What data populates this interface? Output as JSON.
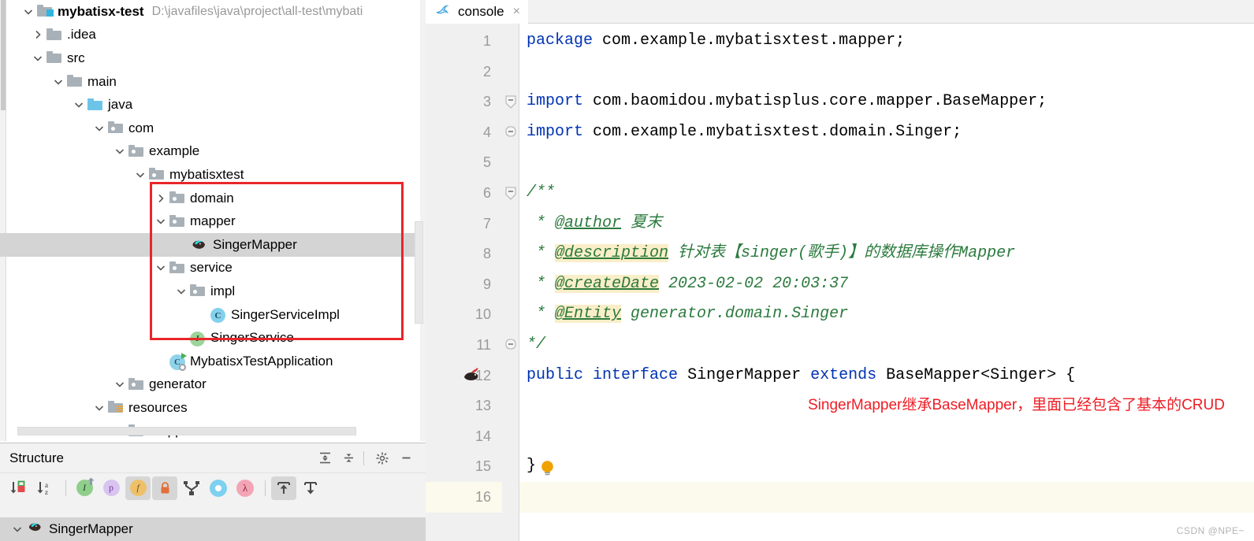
{
  "project": {
    "root": {
      "name": "mybatisx-test",
      "path": "D:\\javafiles\\java\\project\\all-test\\mybati"
    },
    "tree": [
      {
        "label": ".idea",
        "indent": 1,
        "chevron": "right",
        "icon": "folder",
        "selected": false
      },
      {
        "label": "src",
        "indent": 1,
        "chevron": "down",
        "icon": "folder",
        "selected": false
      },
      {
        "label": "main",
        "indent": 2,
        "chevron": "down",
        "icon": "folder",
        "selected": false
      },
      {
        "label": "java",
        "indent": 3,
        "chevron": "down",
        "icon": "folder-blue",
        "selected": false
      },
      {
        "label": "com",
        "indent": 4,
        "chevron": "down",
        "icon": "folder-package",
        "selected": false
      },
      {
        "label": "example",
        "indent": 5,
        "chevron": "down",
        "icon": "folder-package",
        "selected": false
      },
      {
        "label": "mybatisxtest",
        "indent": 6,
        "chevron": "down",
        "icon": "folder-package",
        "selected": false
      },
      {
        "label": "domain",
        "indent": 7,
        "chevron": "right",
        "icon": "folder-package",
        "selected": false
      },
      {
        "label": "mapper",
        "indent": 7,
        "chevron": "down",
        "icon": "folder-package",
        "selected": false
      },
      {
        "label": "SingerMapper",
        "indent": 8,
        "chevron": "none",
        "icon": "mybatis-mapper",
        "selected": true
      },
      {
        "label": "service",
        "indent": 7,
        "chevron": "down",
        "icon": "folder-package",
        "selected": false
      },
      {
        "label": "impl",
        "indent": 8,
        "chevron": "down",
        "icon": "folder-package",
        "selected": false
      },
      {
        "label": "SingerServiceImpl",
        "indent": 9,
        "chevron": "none",
        "icon": "class",
        "selected": false
      },
      {
        "label": "SingerService",
        "indent": 8,
        "chevron": "none",
        "icon": "interface",
        "selected": false
      },
      {
        "label": "MybatisxTestApplication",
        "indent": 7,
        "chevron": "none",
        "icon": "spring-boot",
        "selected": false
      },
      {
        "label": "generator",
        "indent": 5,
        "chevron": "down",
        "icon": "folder-package",
        "selected": false
      },
      {
        "label": "resources",
        "indent": 4,
        "chevron": "down",
        "icon": "folder-resources",
        "selected": false
      },
      {
        "label": "mapper",
        "indent": 5,
        "chevron": "right",
        "icon": "folder",
        "selected": false
      }
    ]
  },
  "structure": {
    "title": "Structure",
    "header_icons": [
      "expand-all-icon",
      "collapse-all-icon",
      "gear-icon",
      "minimize-icon"
    ],
    "toolbar_icons": [
      "sort-by-visibility-icon",
      "sort-alphabetically-icon",
      "show-inherited-icon",
      "show-properties-icon",
      "show-fields-icon",
      "show-non-public-icon",
      "group-by-implementation-icon",
      "show-anonymous-classes-icon",
      "show-lambdas-icon",
      "scroll-from-source-icon",
      "scroll-to-source-icon"
    ],
    "root_item": {
      "label": "SingerMapper",
      "icon": "mybatis-mapper",
      "expanded": true,
      "selected": true
    }
  },
  "editor": {
    "tab": {
      "label": "console",
      "icon": "mysql-dolphin-icon",
      "close": "×"
    },
    "current_line": 16,
    "watermark": "CSDN @NPE~",
    "lines": [
      {
        "n": 1,
        "fold": "none",
        "segments": [
          {
            "t": "package",
            "c": "kw"
          },
          {
            "t": " com.example.mybatisxtest.mapper;",
            "c": "gen"
          }
        ]
      },
      {
        "n": 2,
        "fold": "none",
        "segments": []
      },
      {
        "n": 3,
        "fold": "start",
        "segments": [
          {
            "t": "import",
            "c": "kw"
          },
          {
            "t": " com.baomidou.mybatisplus.core.mapper.BaseMapper;",
            "c": "gen"
          }
        ]
      },
      {
        "n": 4,
        "fold": "end",
        "segments": [
          {
            "t": "import",
            "c": "kw"
          },
          {
            "t": " com.example.mybatisxtest.domain.Singer;",
            "c": "gen"
          }
        ]
      },
      {
        "n": 5,
        "fold": "none",
        "segments": []
      },
      {
        "n": 6,
        "fold": "start",
        "segments": [
          {
            "t": "/**",
            "c": "cmt"
          }
        ]
      },
      {
        "n": 7,
        "fold": "none",
        "segments": [
          {
            "t": " * ",
            "c": "cmt"
          },
          {
            "t": "@author",
            "c": "cmt-tag"
          },
          {
            "t": " 夏末",
            "c": "cmt"
          }
        ]
      },
      {
        "n": 8,
        "fold": "none",
        "segments": [
          {
            "t": " * ",
            "c": "cmt"
          },
          {
            "t": "@description",
            "c": "cmt-tag hl"
          },
          {
            "t": " 针对表【singer(歌手)】的数据库操作Mapper",
            "c": "cmt"
          }
        ]
      },
      {
        "n": 9,
        "fold": "none",
        "segments": [
          {
            "t": " * ",
            "c": "cmt"
          },
          {
            "t": "@createDate",
            "c": "cmt-tag hl"
          },
          {
            "t": " 2023-02-02 20:03:37",
            "c": "cmt"
          }
        ]
      },
      {
        "n": 10,
        "fold": "none",
        "segments": [
          {
            "t": " * ",
            "c": "cmt"
          },
          {
            "t": "@Entity",
            "c": "cmt-tag hl"
          },
          {
            "t": " generator.domain.Singer",
            "c": "cmt"
          }
        ]
      },
      {
        "n": 11,
        "fold": "end",
        "segments": [
          {
            "t": "*/",
            "c": "cmt"
          }
        ]
      },
      {
        "n": 12,
        "fold": "none",
        "gutter_icon": "mybatis-bird-icon",
        "segments": [
          {
            "t": "public",
            "c": "kw"
          },
          {
            "t": " ",
            "c": "gen"
          },
          {
            "t": "interface",
            "c": "kw"
          },
          {
            "t": " SingerMapper ",
            "c": "gen"
          },
          {
            "t": "extends",
            "c": "kw"
          },
          {
            "t": " BaseMapper<Singer> {",
            "c": "gen"
          }
        ]
      },
      {
        "n": 13,
        "fold": "none",
        "annotation": "SingerMapper继承BaseMapper，里面已经包含了基本的CRUD",
        "segments": []
      },
      {
        "n": 14,
        "fold": "none",
        "segments": []
      },
      {
        "n": 15,
        "fold": "none",
        "bulb": true,
        "segments": [
          {
            "t": "}",
            "c": "gen"
          }
        ]
      },
      {
        "n": 16,
        "fold": "none",
        "segments": []
      }
    ]
  },
  "colors": {
    "keyword": "#0033b3",
    "comment": "#2b7a3d",
    "annotation_red": "#ee1c24",
    "highlight_box": "#e8262a",
    "doc_tag_highlight": "#faeec8",
    "selection": "#d4d4d4",
    "current_line": "#fcfaec"
  }
}
